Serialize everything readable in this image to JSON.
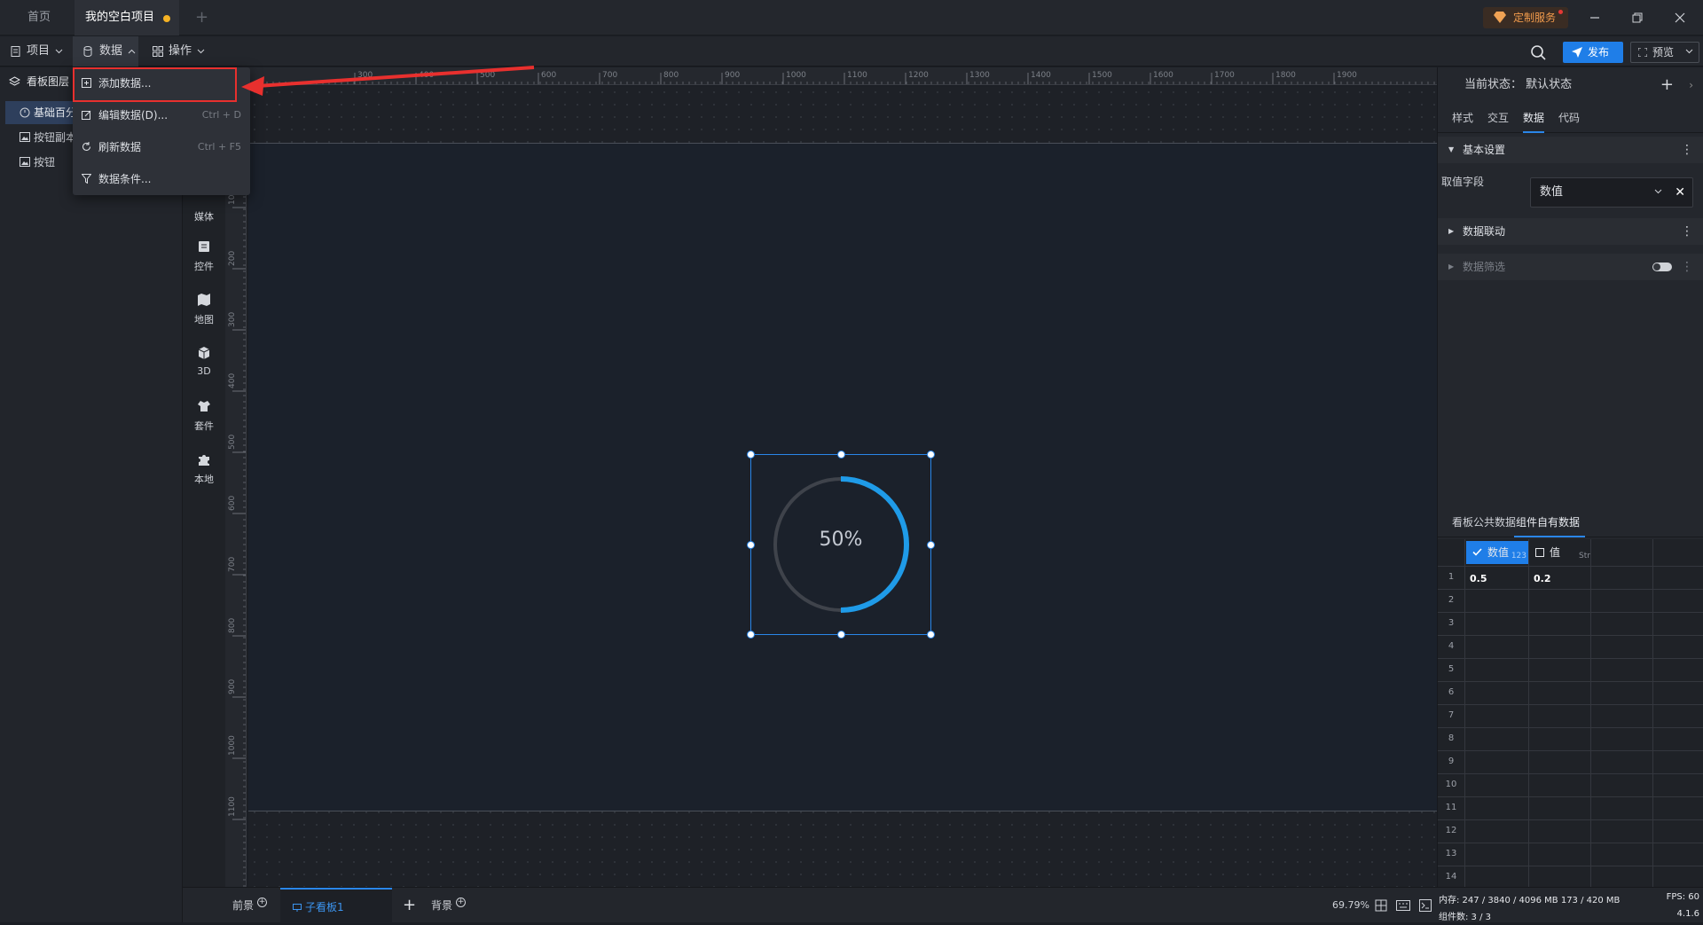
{
  "titlebar": {
    "tabs": [
      {
        "label": "首页"
      },
      {
        "label": "我的空白项目"
      }
    ],
    "custom_service": "定制服务"
  },
  "menubar": {
    "project": "项目",
    "data": "数据",
    "operation": "操作",
    "publish": "发布",
    "preview": "预览"
  },
  "dropdown": {
    "items": [
      {
        "label": "添加数据...",
        "shortcut": ""
      },
      {
        "label": "编辑数据(D)...",
        "shortcut": "Ctrl + D"
      },
      {
        "label": "刷新数据",
        "shortcut": "Ctrl + F5"
      },
      {
        "label": "数据条件...",
        "shortcut": ""
      }
    ]
  },
  "layers": {
    "title": "看板图层",
    "items": [
      {
        "label": "基础百分"
      },
      {
        "label": "按钮副本"
      },
      {
        "label": "按钮"
      }
    ]
  },
  "categories": [
    {
      "label": "媒体",
      "icon": "media-icon"
    },
    {
      "label": "控件",
      "icon": "widget-icon"
    },
    {
      "label": "地图",
      "icon": "map-icon"
    },
    {
      "label": "3D",
      "icon": "cube-icon"
    },
    {
      "label": "套件",
      "icon": "suit-icon"
    },
    {
      "label": "本地",
      "icon": "puzzle-icon"
    }
  ],
  "ruler": {
    "top_labels": [
      "300",
      "400",
      "500",
      "600",
      "700",
      "800",
      "900",
      "1000",
      "1100",
      "1200",
      "1300",
      "1400",
      "1500",
      "1600",
      "1700",
      "1800",
      "1900"
    ],
    "left_labels": [
      "100",
      "200",
      "300",
      "400",
      "500",
      "600",
      "700",
      "800",
      "900",
      "1000",
      "1100"
    ]
  },
  "gauge": {
    "value": 0.5,
    "label": "50%",
    "color": "#1f9be8",
    "track": "#3f434b"
  },
  "right_panel": {
    "state": "当前状态：  默认状态",
    "tabs": [
      {
        "label": "样式"
      },
      {
        "label": "交互"
      },
      {
        "label": "数据"
      },
      {
        "label": "代码"
      }
    ],
    "basic_settings": "基本设置",
    "field_label": "取值字段",
    "field_value": "数值",
    "data_link": "数据联动",
    "data_filter": "数据筛选"
  },
  "data_table": {
    "tabs": [
      {
        "label": "看板公共数据"
      },
      {
        "label": "组件自有数据"
      }
    ],
    "columns": [
      {
        "name": "数值",
        "type": "123"
      },
      {
        "name": "值",
        "type": "Str"
      }
    ],
    "rows": [
      [
        "0.5",
        "0.2"
      ]
    ],
    "row_numbers": [
      "1",
      "2",
      "3",
      "4",
      "5",
      "6",
      "7",
      "8",
      "9",
      "10",
      "11",
      "12",
      "13",
      "14"
    ]
  },
  "bottom": {
    "front": "前景",
    "sub_board": "子看板1",
    "background": "背景",
    "zoom": "69.79%"
  },
  "status": {
    "memory": "内存:  247 / 3840 / 4096 MB  173 / 420 MB",
    "fps": "FPS:  60",
    "components": "组件数: 3 / 3",
    "version": "4.1.6"
  }
}
